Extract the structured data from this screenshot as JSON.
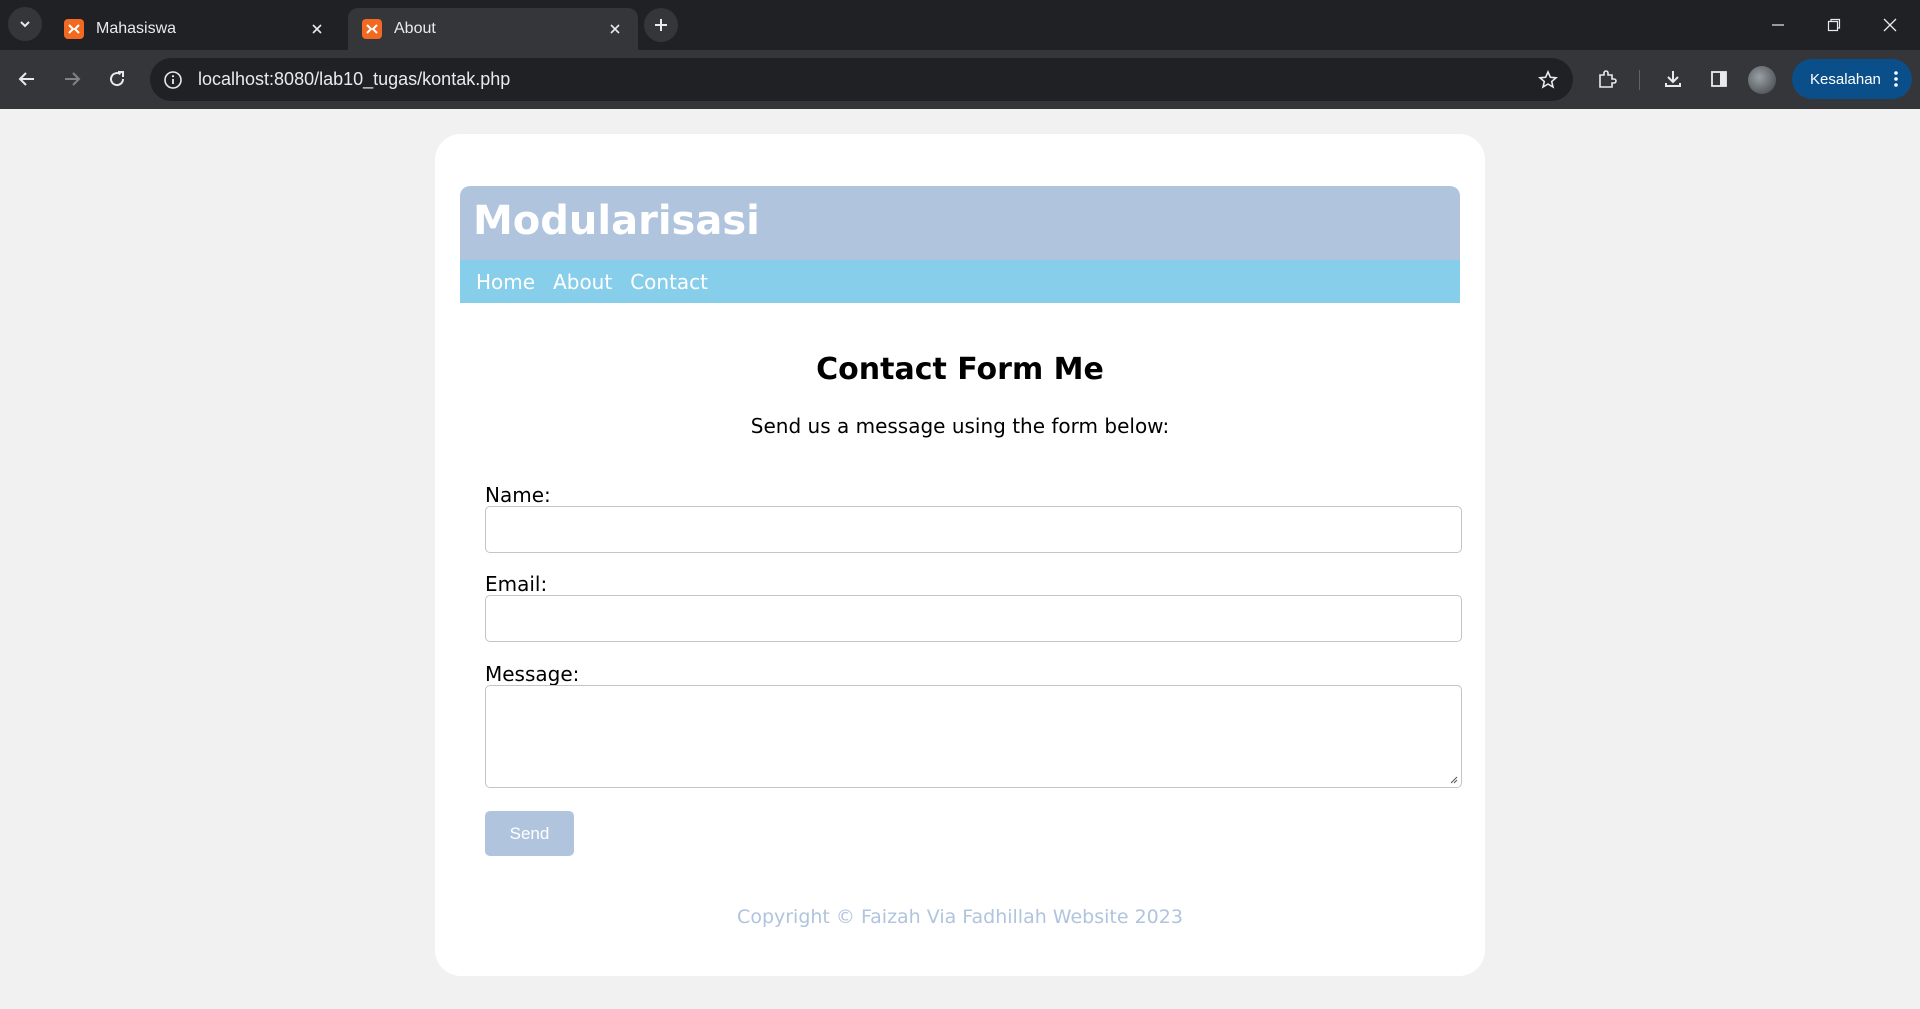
{
  "browser": {
    "tabs": [
      {
        "title": "Mahasiswa",
        "favicon": "xampp-icon",
        "active": false
      },
      {
        "title": "About",
        "favicon": "xampp-icon",
        "active": true
      }
    ],
    "url": "localhost:8080/lab10_tugas/kontak.php",
    "error_button_label": "Kesalahan",
    "colors": {
      "tabstrip": "#202124",
      "toolbar": "#35363a",
      "error_pill": "#0b4f8a"
    }
  },
  "site": {
    "title": "Modularisasi",
    "nav": [
      {
        "label": "Home"
      },
      {
        "label": "About"
      },
      {
        "label": "Contact"
      }
    ],
    "colors": {
      "header": "#b0c4de",
      "nav": "#87ceeb"
    }
  },
  "contact": {
    "heading": "Contact Form Me",
    "subheading": "Send us a message using the form below:",
    "name_label": "Name:",
    "name_value": "",
    "email_label": "Email:",
    "email_value": "",
    "message_label": "Message:",
    "message_value": "",
    "send_label": "Send"
  },
  "footer": {
    "copyright": "Copyright © Faizah Via Fadhillah Website 2023"
  }
}
